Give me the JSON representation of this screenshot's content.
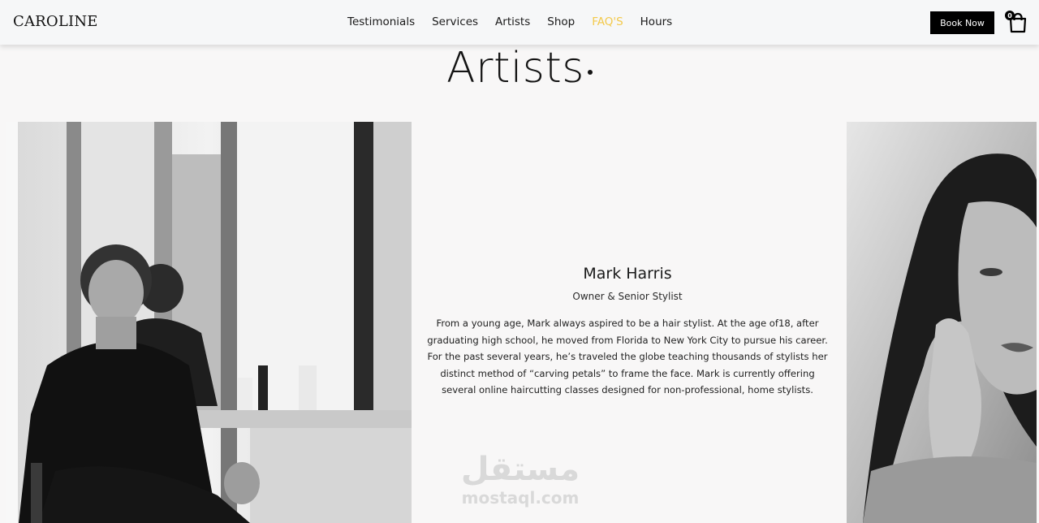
{
  "brand": "CAROLINE",
  "nav": {
    "links": [
      {
        "label": "Testimonials",
        "active": false
      },
      {
        "label": "Services",
        "active": false
      },
      {
        "label": "Artists",
        "active": false
      },
      {
        "label": "Shop",
        "active": false
      },
      {
        "label": "FAQ'S",
        "active": true
      },
      {
        "label": "Hours",
        "active": false
      }
    ],
    "book_label": "Book Now",
    "cart_count": "0"
  },
  "section": {
    "title": "Artists"
  },
  "artist": {
    "name": "Mark Harris",
    "role": "Owner & Senior Stylist",
    "bio": "From a young age, Mark always aspired to be a hair stylist. At the age of18, after graduating high school, he moved from Florida to New York City to pursue his career. For the past several years, he’s traveled the globe teaching thousands of stylists her distinct method of “carving petals” to frame the face. Mark is currently offering several online haircutting classes designed for non-professional, home stylists."
  },
  "watermark": {
    "arabic": "مستقل",
    "latin": "mostaql.com"
  },
  "colors": {
    "accent": "#f3c94a",
    "button_bg": "#000000",
    "page_bg": "#f8f7f7"
  }
}
